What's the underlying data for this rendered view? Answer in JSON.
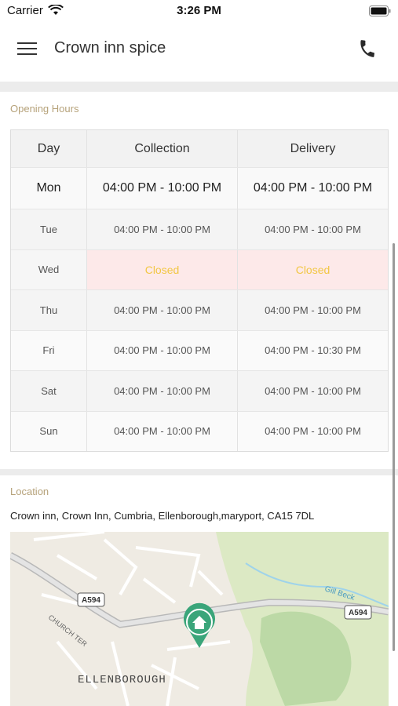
{
  "status_bar": {
    "carrier": "Carrier",
    "time": "3:26 PM"
  },
  "header": {
    "title": "Crown inn spice"
  },
  "opening_hours": {
    "label": "Opening Hours",
    "columns": [
      "Day",
      "Collection",
      "Delivery"
    ],
    "rows": [
      {
        "day": "Mon",
        "collection": "04:00 PM - 10:00 PM",
        "delivery": "04:00 PM - 10:00 PM"
      },
      {
        "day": "Tue",
        "collection": "04:00 PM - 10:00 PM",
        "delivery": "04:00 PM - 10:00 PM"
      },
      {
        "day": "Wed",
        "collection": "Closed",
        "delivery": "Closed"
      },
      {
        "day": "Thu",
        "collection": "04:00 PM - 10:00 PM",
        "delivery": "04:00 PM - 10:00 PM"
      },
      {
        "day": "Fri",
        "collection": "04:00 PM - 10:00 PM",
        "delivery": "04:00 PM - 10:30 PM"
      },
      {
        "day": "Sat",
        "collection": "04:00 PM - 10:00 PM",
        "delivery": "04:00 PM - 10:00 PM"
      },
      {
        "day": "Sun",
        "collection": "04:00 PM - 10:00 PM",
        "delivery": "04:00 PM - 10:00 PM"
      }
    ]
  },
  "location": {
    "label": "Location",
    "address": "Crown inn, Crown Inn, Cumbria, Ellenborough,maryport, CA15 7DL",
    "map": {
      "road_badges": [
        "A594",
        "A594"
      ],
      "street_label": "CHURCH TER",
      "place_label": "ELLENBOROUGH",
      "river_label": "Gill Beck",
      "marker_icon": "home-icon"
    }
  },
  "colors": {
    "accent_label": "#b6a27a",
    "closed_bg": "#fde9e9",
    "closed_text": "#f2c744",
    "marker": "#3aa57a"
  }
}
